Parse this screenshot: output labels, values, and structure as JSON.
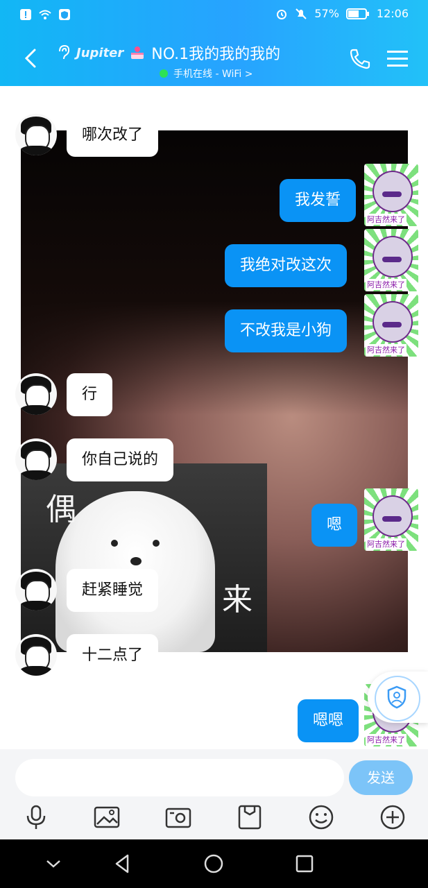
{
  "status": {
    "battery": "57%",
    "time": "12:06"
  },
  "header": {
    "brand": "Jupiter",
    "title": "NO.1我的我的我的",
    "subtitle": "手机在线 - WiFi >"
  },
  "messages": [
    {
      "side": "in",
      "text": "哪次改了"
    },
    {
      "side": "out",
      "text": "我发誓"
    },
    {
      "side": "out",
      "text": "我绝对改这次"
    },
    {
      "side": "out",
      "text": "不改我是小狗"
    },
    {
      "side": "in",
      "text": "行"
    },
    {
      "side": "in",
      "text": "你自己说的"
    },
    {
      "side": "out",
      "text": "嗯"
    },
    {
      "side": "in",
      "text": "赶紧睡觉"
    },
    {
      "side": "in",
      "text": "十二点了"
    },
    {
      "side": "out",
      "text": "嗯嗯"
    }
  ],
  "meme": {
    "caption_left": "偶",
    "caption_right": "来"
  },
  "sticker_label": "阿吉然来了",
  "input": {
    "placeholder": "",
    "send_label": "发送"
  },
  "icons": [
    "mic-icon",
    "image-icon",
    "camera-icon",
    "folder-icon",
    "emoji-icon",
    "plus-icon"
  ]
}
